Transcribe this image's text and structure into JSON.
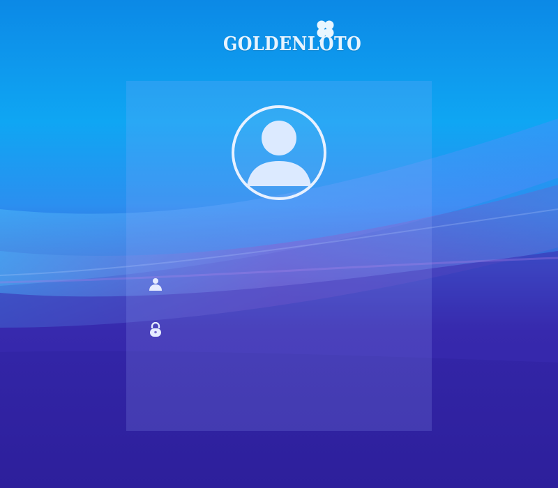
{
  "brand": {
    "name": "GOLDENLOTO"
  },
  "login": {
    "username_value": "",
    "password_value": ""
  },
  "icons": {
    "logo": "four-leaf-clover-icon",
    "avatar": "user-avatar-icon",
    "username": "user-icon",
    "password": "lock-icon"
  },
  "colors": {
    "top_background": "#0b8fe6",
    "bottom_background": "#2f219d",
    "panel_overlay": "#a0afff",
    "text": "#e7f4ff"
  }
}
